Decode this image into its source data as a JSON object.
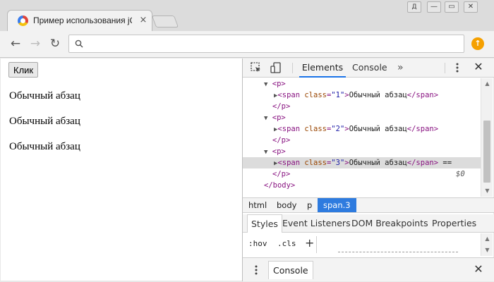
{
  "tab": {
    "title": "Пример использования jQuery",
    "close": "×"
  },
  "window": {
    "user_glyph": "Д",
    "minimize": "—",
    "restore": "▭",
    "close": "✕"
  },
  "toolbar": {
    "back": "←",
    "forward": "→",
    "reload": "↻",
    "address_value": "",
    "extension_glyph": "↑"
  },
  "page": {
    "button_label": "Клик",
    "paragraphs": [
      "Обычный абзац",
      "Обычный абзац",
      "Обычный абзац"
    ]
  },
  "devtools": {
    "tabs": [
      "Elements",
      "Console"
    ],
    "active_tab": "Elements",
    "more": "»",
    "close": "✕",
    "dom": {
      "p_open": "<p>",
      "p_close": "</p>",
      "span_open": "<span",
      "span_close": "</span>",
      "attr_name": "class",
      "attr_values": [
        "\"1\"",
        "\"2\"",
        "\"3\""
      ],
      "text": "Обычный абзац",
      "body_close": "</body>",
      "selected_suffix": "==",
      "selected_ref": "$0"
    },
    "breadcrumbs": [
      "html",
      "body",
      "p",
      "span.3"
    ],
    "active_breadcrumb": "span.3",
    "styles_tabs": [
      "Styles",
      "Event Listeners",
      "DOM Breakpoints",
      "Properties"
    ],
    "active_styles_tab": "Styles",
    "filter": {
      "hov": ":hov",
      "cls": ".cls",
      "add": "+"
    },
    "drawer": {
      "tab": "Console",
      "close": "✕"
    }
  },
  "colors": {
    "active_tab_underline": "#1a73e8",
    "selected_crumb": "#2e7bdf",
    "tag": "#881280",
    "attr_name": "#994500",
    "attr_value": "#1a1aa6"
  }
}
